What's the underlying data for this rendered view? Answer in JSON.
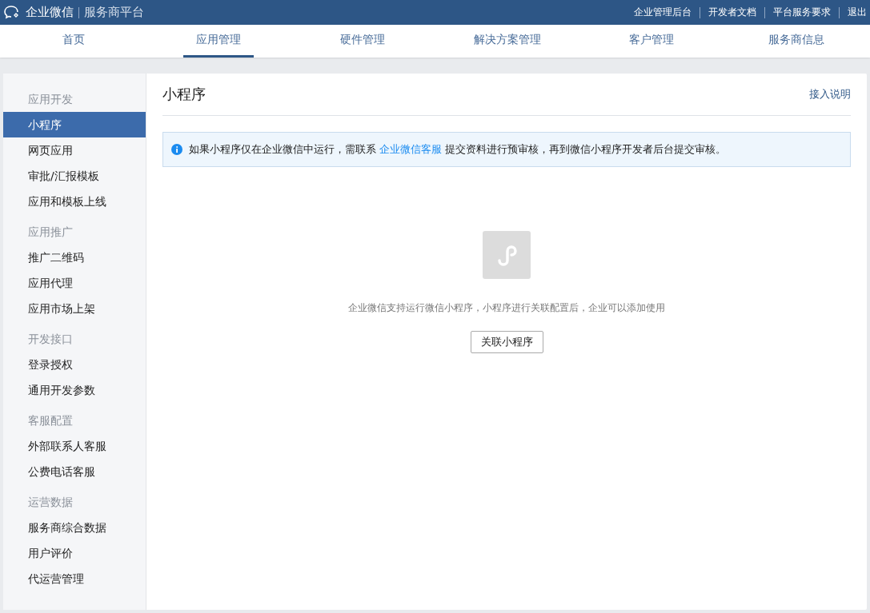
{
  "header": {
    "logo_text": "企业微信",
    "platform": "服务商平台",
    "links": [
      "企业管理后台",
      "开发者文档",
      "平台服务要求",
      "退出"
    ]
  },
  "nav_tabs": [
    {
      "label": "首页",
      "selected": false
    },
    {
      "label": "应用管理",
      "selected": true
    },
    {
      "label": "硬件管理",
      "selected": false
    },
    {
      "label": "解决方案管理",
      "selected": false
    },
    {
      "label": "客户管理",
      "selected": false
    },
    {
      "label": "服务商信息",
      "selected": false
    }
  ],
  "sidebar": {
    "groups": [
      {
        "title": "应用开发",
        "items": [
          {
            "label": "小程序",
            "selected": true
          },
          {
            "label": "网页应用",
            "selected": false
          },
          {
            "label": "审批/汇报模板",
            "selected": false
          },
          {
            "label": "应用和模板上线",
            "selected": false
          }
        ]
      },
      {
        "title": "应用推广",
        "items": [
          {
            "label": "推广二维码",
            "selected": false
          },
          {
            "label": "应用代理",
            "selected": false
          },
          {
            "label": "应用市场上架",
            "selected": false
          }
        ]
      },
      {
        "title": "开发接口",
        "items": [
          {
            "label": "登录授权",
            "selected": false
          },
          {
            "label": "通用开发参数",
            "selected": false
          }
        ]
      },
      {
        "title": "客服配置",
        "items": [
          {
            "label": "外部联系人客服",
            "selected": false
          },
          {
            "label": "公费电话客服",
            "selected": false
          }
        ]
      },
      {
        "title": "运营数据",
        "items": [
          {
            "label": "服务商综合数据",
            "selected": false
          },
          {
            "label": "用户评价",
            "selected": false
          },
          {
            "label": "代运营管理",
            "selected": false
          }
        ]
      }
    ]
  },
  "content": {
    "title": "小程序",
    "help_link": "接入说明",
    "notice": {
      "before": "如果小程序仅在企业微信中运行，需联系 ",
      "link": "企业微信客服",
      "after": " 提交资料进行预审核，再到微信小程序开发者后台提交审核。"
    },
    "empty_state": {
      "description": "企业微信支持运行微信小程序，小程序进行关联配置后，企业可以添加使用",
      "button": "关联小程序"
    }
  }
}
